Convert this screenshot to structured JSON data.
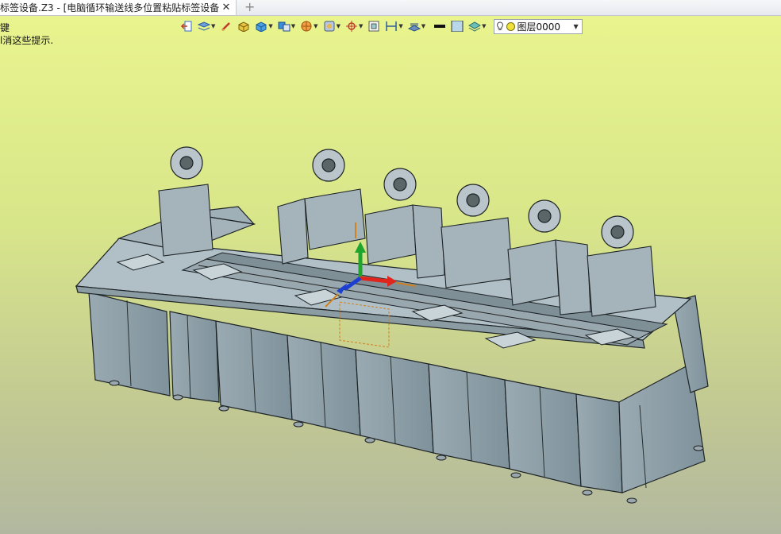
{
  "tab": {
    "title": "标签设备.Z3 - [电脑循环输送线多位置粘贴标签设备]",
    "close": "✕",
    "add": "+"
  },
  "hints": [
    "键",
    "l消这些提示."
  ],
  "layer": {
    "name": "图层0000"
  },
  "colors": {
    "accent": "#2f6fd1",
    "machine": "#8ea1aa",
    "outline": "#1d2326"
  },
  "toolbar_icons": [
    "exit-icon",
    "layers-icon",
    "brush-icon",
    "solid-box-icon",
    "cube-icon",
    "blocks-icon",
    "sphere-segments-icon",
    "view-cube-icon",
    "pivot-icon",
    "frame-icon",
    "dimension-icon",
    "grid-icon",
    "line-style-icon",
    "fill-color-icon",
    "material-icon"
  ]
}
